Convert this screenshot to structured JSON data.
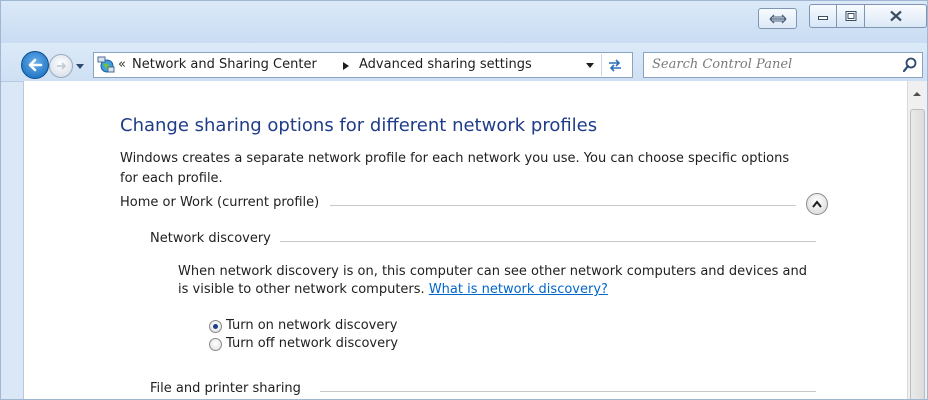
{
  "window": {
    "caption": {
      "restore_icon": "double-arrow-icon",
      "minimize_icon": "minimize-icon",
      "maximize_icon": "maximize-icon",
      "close_icon": "close-icon"
    }
  },
  "navbar": {
    "breadcrumb": {
      "overflow": "«",
      "items": [
        "Network and Sharing Center",
        "Advanced sharing settings"
      ]
    },
    "search_placeholder": "Search Control Panel"
  },
  "main": {
    "title": "Change sharing options for different network profiles",
    "description": "Windows creates a separate network profile for each network you use. You can choose specific options for each profile.",
    "profile": {
      "label": "Home or Work (current profile)",
      "expanded": true,
      "sections": [
        {
          "label": "Network discovery",
          "text": "When network discovery is on, this computer can see other network computers and devices and is visible to other network computers.",
          "link": "What is network discovery?",
          "options": [
            {
              "label": "Turn on network discovery",
              "checked": true
            },
            {
              "label": "Turn off network discovery",
              "checked": false
            }
          ]
        },
        {
          "label": "File and printer sharing"
        }
      ]
    }
  },
  "colors": {
    "title": "#1f3c88",
    "link": "#0066cc",
    "chrome": "#d9e7f7"
  }
}
